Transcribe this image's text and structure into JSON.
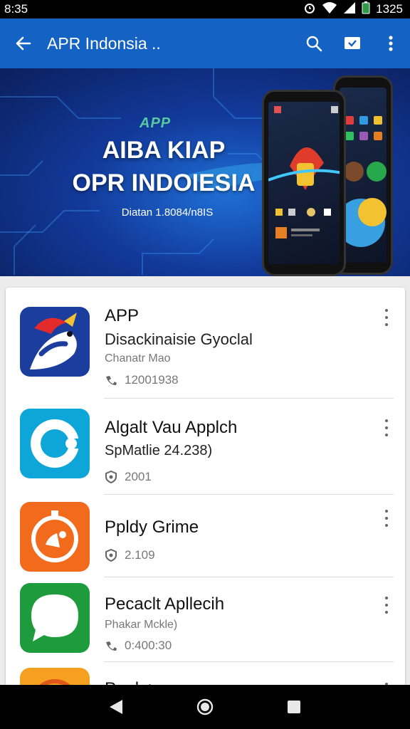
{
  "status_bar": {
    "time": "8:35",
    "clock": "1325",
    "icons": [
      "alarm-icon",
      "wifi-icon",
      "signal-icon",
      "battery-icon"
    ]
  },
  "app_bar": {
    "title": "APR Indonsia ..",
    "icons": [
      "back-arrow-icon",
      "search-icon",
      "cast-icon",
      "more-vert-icon"
    ]
  },
  "banner": {
    "logo": "APP",
    "title_line1": "AIBA KIAP",
    "title_line2": "OPR INDOIESIA",
    "subtitle": "Diatan 1.8084/n8IS"
  },
  "apps": [
    {
      "title": "APP",
      "subtitle": "Disackinaisie Gyoclal",
      "meta": "Chanatr Mao",
      "stat_icon": "phone-icon",
      "stat": "12001938"
    },
    {
      "title": "Algalt Vau Applch",
      "subtitle": "SpMatlie 24.238)",
      "stat_icon": "shield-icon",
      "stat": "2001"
    },
    {
      "title": "Ppldy Grime",
      "stat_icon": "shield-icon",
      "stat": "2.109"
    },
    {
      "title": "Pecaclt Apllecih",
      "meta": "Phakar Mckle)",
      "stat_icon": "phone-icon",
      "stat": "0:400:30"
    },
    {
      "title": "Peak >"
    }
  ],
  "colors": {
    "app_bar": "#1462c4",
    "banner_dark": "#0b1f5c",
    "icon_blue": "#1a3d9e",
    "icon_cyan": "#0ea5d8",
    "icon_orange": "#f26b1d",
    "icon_green": "#1e9b3c",
    "icon_amber": "#f5a020"
  },
  "nav_bar": {
    "icons": [
      "back-triangle-icon",
      "home-circle-icon",
      "recents-square-icon"
    ]
  }
}
